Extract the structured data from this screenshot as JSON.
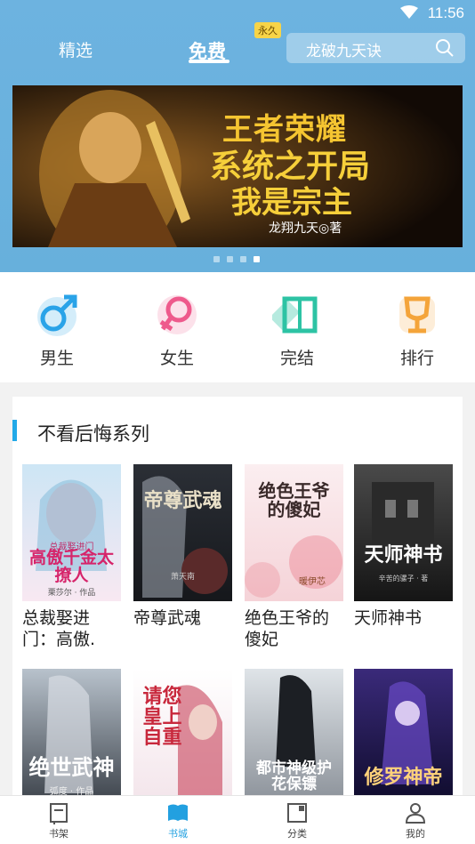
{
  "status_bar": {
    "time": "11:56"
  },
  "header": {
    "tabs": [
      {
        "label": "精选"
      },
      {
        "label": "免费",
        "badge": "永久"
      }
    ],
    "search": {
      "text": "龙破九天诀"
    }
  },
  "banner": {
    "line1": "王者荣耀",
    "line2": "系统之开局",
    "line3": "我是宗主",
    "author": "龙翔九天◎著"
  },
  "categories": [
    {
      "label": "男生",
      "icon": "male-icon",
      "color": "#2aa3e8"
    },
    {
      "label": "女生",
      "icon": "female-icon",
      "color": "#ee5a8c"
    },
    {
      "label": "完结",
      "icon": "book-icon",
      "color": "#2dc3a4"
    },
    {
      "label": "排行",
      "icon": "trophy-icon",
      "color": "#f4a43a"
    }
  ],
  "section": {
    "title": "不看后悔系列",
    "books": [
      {
        "title": "总裁娶进门：高傲.",
        "cover_text": "高傲千金太撩人",
        "cover_small": "总裁娶进门",
        "cover_author": "栗莎尔 · 作品"
      },
      {
        "title": "帝尊武魂",
        "cover_text": "帝尊武魂",
        "cover_small": "",
        "cover_author": "萧天南"
      },
      {
        "title": "绝色王爷的傻妃",
        "cover_text": "绝色王爷的傻妃",
        "cover_small": "",
        "cover_author": "暖伊芯"
      },
      {
        "title": "天师神书",
        "cover_text": "天师神书",
        "cover_small": "",
        "cover_author": "辛苦的骡子 · 著"
      },
      {
        "title": "",
        "cover_text": "绝世武神",
        "cover_small": "",
        "cover_author": "弧度 · 作品"
      },
      {
        "title": "",
        "cover_text": "请您皇上自重",
        "cover_small": "",
        "cover_author": ""
      },
      {
        "title": "",
        "cover_text": "都市神级护花保镖",
        "cover_small": "",
        "cover_author": ""
      },
      {
        "title": "",
        "cover_text": "修罗神帝",
        "cover_small": "",
        "cover_author": ""
      }
    ]
  },
  "bottom_nav": [
    {
      "label": "书架",
      "active": false
    },
    {
      "label": "书城",
      "active": true
    },
    {
      "label": "分类",
      "active": false
    },
    {
      "label": "我的",
      "active": false
    }
  ]
}
